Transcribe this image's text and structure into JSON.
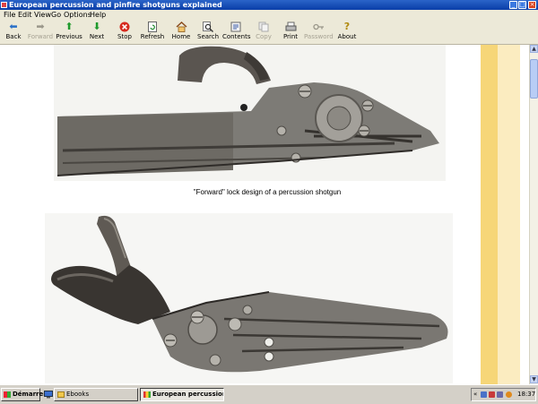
{
  "window": {
    "title": "European percussion and pinfire shotguns explained",
    "controls": [
      "_",
      "□",
      "×"
    ]
  },
  "menu": [
    "File",
    "Edit",
    "View",
    "Go",
    "Options",
    "Help"
  ],
  "toolbar": [
    {
      "label": "Back",
      "icon": "back-arrow-icon",
      "enabled": true
    },
    {
      "label": "Forward",
      "icon": "forward-arrow-icon",
      "enabled": false
    },
    {
      "label": "Previous",
      "icon": "up-arrow-icon",
      "enabled": true
    },
    {
      "label": "Next",
      "icon": "down-arrow-icon",
      "enabled": true
    },
    {
      "label": "Stop",
      "icon": "stop-icon",
      "enabled": true
    },
    {
      "label": "Refresh",
      "icon": "refresh-icon",
      "enabled": true
    },
    {
      "label": "Home",
      "icon": "home-icon",
      "enabled": true
    },
    {
      "label": "Search",
      "icon": "search-icon",
      "enabled": true
    },
    {
      "label": "Contents",
      "icon": "contents-icon",
      "enabled": true
    },
    {
      "label": "Copy",
      "icon": "copy-icon",
      "enabled": false
    },
    {
      "label": "Print",
      "icon": "print-icon",
      "enabled": true
    },
    {
      "label": "Password",
      "icon": "key-icon",
      "enabled": false
    },
    {
      "label": "About",
      "icon": "help-icon",
      "enabled": true
    }
  ],
  "content": {
    "caption": "\"Forward\" lock design of a percussion shotgun"
  },
  "taskbar": {
    "start_label": "Démarrer",
    "tasks": [
      {
        "label": "Ebooks",
        "active": false
      },
      {
        "label": "European percussion ...",
        "active": true
      }
    ],
    "clock": "18:37",
    "tray_chevron": "«"
  },
  "colors": {
    "titlebar": "#0a3ea8",
    "stripe_gold": "#f6d678",
    "stripe_cream": "#fbecc0"
  }
}
